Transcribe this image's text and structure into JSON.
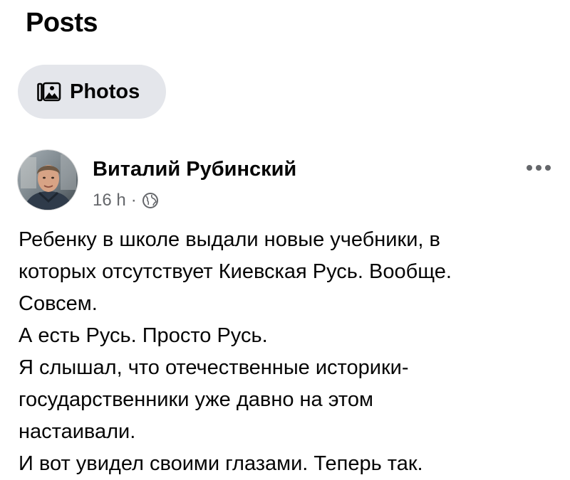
{
  "page": {
    "title": "Posts"
  },
  "filters": {
    "photos_label": "Photos",
    "photos_icon": "photos-icon"
  },
  "post": {
    "author_name": "Виталий Рубинский",
    "time": "16 h",
    "separator": "·",
    "privacy_icon": "globe-icon",
    "more_icon": "more-options-icon",
    "lines": [
      "Ребенку в школе выдали новые учебники, в",
      "которых отсутствует Киевская Русь. Вообще.",
      "Совсем.",
      "А есть Русь. Просто Русь.",
      "Я слышал, что отечественные историки-",
      "государственники уже давно на этом",
      "настаивали.",
      "И вот увидел своими глазами. Теперь так."
    ]
  },
  "colors": {
    "chip_background": "#e4e6eb",
    "primary_text": "#050505",
    "secondary_text": "#65676b"
  }
}
